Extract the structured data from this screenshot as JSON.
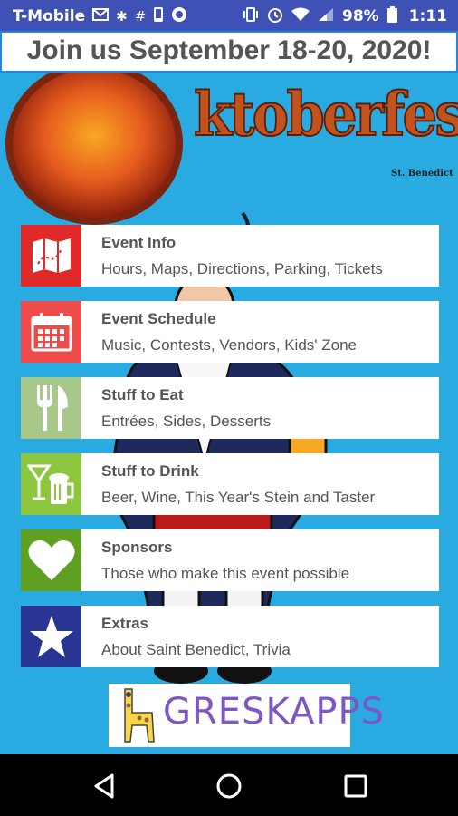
{
  "status_bar": {
    "carrier": "T-Mobile",
    "battery": "98%",
    "time": "1:11"
  },
  "banner": {
    "text": "Join us September 18-20, 2020!"
  },
  "logo": {
    "title": "ktoberfest",
    "subtitle": "St. Benedict"
  },
  "menu": [
    {
      "title": "Event Info",
      "subtitle": "Hours, Maps, Directions, Parking, Tickets",
      "icon": "map-icon",
      "color": "#e02a2a"
    },
    {
      "title": "Event Schedule",
      "subtitle": "Music, Contests, Vendors, Kids' Zone",
      "icon": "calendar-icon",
      "color": "#f04b4b"
    },
    {
      "title": "Stuff to Eat",
      "subtitle": "Entrées, Sides, Desserts",
      "icon": "fork-knife-icon",
      "color": "#a8c88a"
    },
    {
      "title": "Stuff to Drink",
      "subtitle": "Beer, Wine, This Year's Stein and Taster",
      "icon": "drinks-icon",
      "color": "#8dc63f"
    },
    {
      "title": "Sponsors",
      "subtitle": "Those who make this event possible",
      "icon": "heart-icon",
      "color": "#5fa023"
    },
    {
      "title": "Extras",
      "subtitle": "About Saint Benedict, Trivia",
      "icon": "star-icon",
      "color": "#283593"
    }
  ],
  "footer": {
    "brand": "GRESKAPPS"
  },
  "colors": {
    "status_bar": "#3f51b5",
    "app_background": "#29abe2",
    "banner_border": "#1e88e5"
  }
}
